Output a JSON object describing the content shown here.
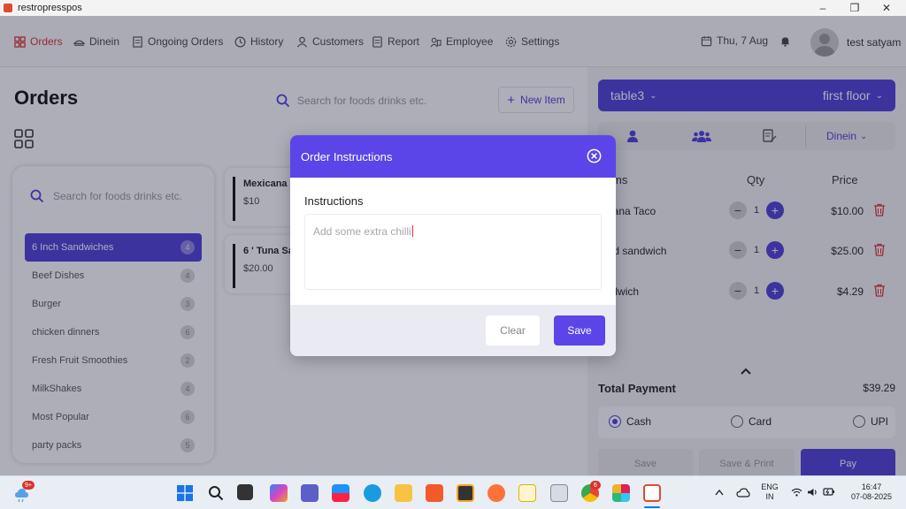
{
  "window": {
    "title": "restropresspos",
    "min": "–",
    "max": "❐",
    "close": "✕"
  },
  "nav": {
    "items": [
      {
        "label": "Orders",
        "icon": "orders-icon"
      },
      {
        "label": "Dinein",
        "icon": "dinein-icon"
      },
      {
        "label": "Ongoing Orders",
        "icon": "ongoing-orders-icon"
      },
      {
        "label": "History",
        "icon": "history-icon"
      },
      {
        "label": "Customers",
        "icon": "customers-icon"
      },
      {
        "label": "Report",
        "icon": "report-icon"
      },
      {
        "label": "Employee",
        "icon": "employee-icon"
      },
      {
        "label": "Settings",
        "icon": "settings-icon"
      }
    ],
    "date": "Thu, 7 Aug",
    "username": "test satyam"
  },
  "page": {
    "title": "Orders"
  },
  "top_search": {
    "placeholder": "Search for foods drinks etc."
  },
  "new_item": {
    "label": "New Item"
  },
  "categories": {
    "search_placeholder": "Search for foods drinks etc.",
    "items": [
      {
        "name": "6 Inch Sandwiches",
        "count": "4"
      },
      {
        "name": "Beef Dishes",
        "count": "4"
      },
      {
        "name": "Burger",
        "count": "3"
      },
      {
        "name": "chicken dinners",
        "count": "6"
      },
      {
        "name": "Fresh Fruit Smoothies",
        "count": "2"
      },
      {
        "name": "MilkShakes",
        "count": "4"
      },
      {
        "name": "Most Popular",
        "count": "6"
      },
      {
        "name": "party packs",
        "count": "5"
      }
    ]
  },
  "foods": [
    {
      "name": "Mexicana",
      "price": "$10"
    },
    {
      "name": "6 ' Tuna Sa",
      "price": "$20.00"
    }
  ],
  "order": {
    "table": "table3",
    "floor": "first floor",
    "type": "Dinein",
    "headers": {
      "items": "ms",
      "qty": "Qty",
      "price": "Price"
    },
    "rows": [
      {
        "name": "xicana Taco",
        "qty": "1",
        "price": "$10.00"
      },
      {
        "name": "cold sandwich",
        "qty": "1",
        "price": "$25.00"
      },
      {
        "name": "andwich",
        "qty": "1",
        "price": "$4.29"
      }
    ],
    "total_label": "Total Payment",
    "total_value": "$39.29",
    "payment_methods": [
      {
        "label": "Cash",
        "selected": true
      },
      {
        "label": "Card",
        "selected": false
      },
      {
        "label": "UPI",
        "selected": false
      }
    ],
    "buttons": {
      "save": "Save",
      "save_print": "Save & Print",
      "pay": "Pay"
    }
  },
  "modal": {
    "title": "Order Instructions",
    "label": "Instructions",
    "text": "Add some extra chilli",
    "clear": "Clear",
    "save": "Save"
  },
  "taskbar": {
    "notif": "9+",
    "lang": "ENG",
    "region": "IN",
    "time": "16:47",
    "date": "07-08-2025",
    "chrome_badge": "6"
  },
  "colors": {
    "accent": "#4e3fd6",
    "modal_accent": "#5b45e8",
    "active_nav": "#d9342b",
    "delete": "#d9342b"
  }
}
